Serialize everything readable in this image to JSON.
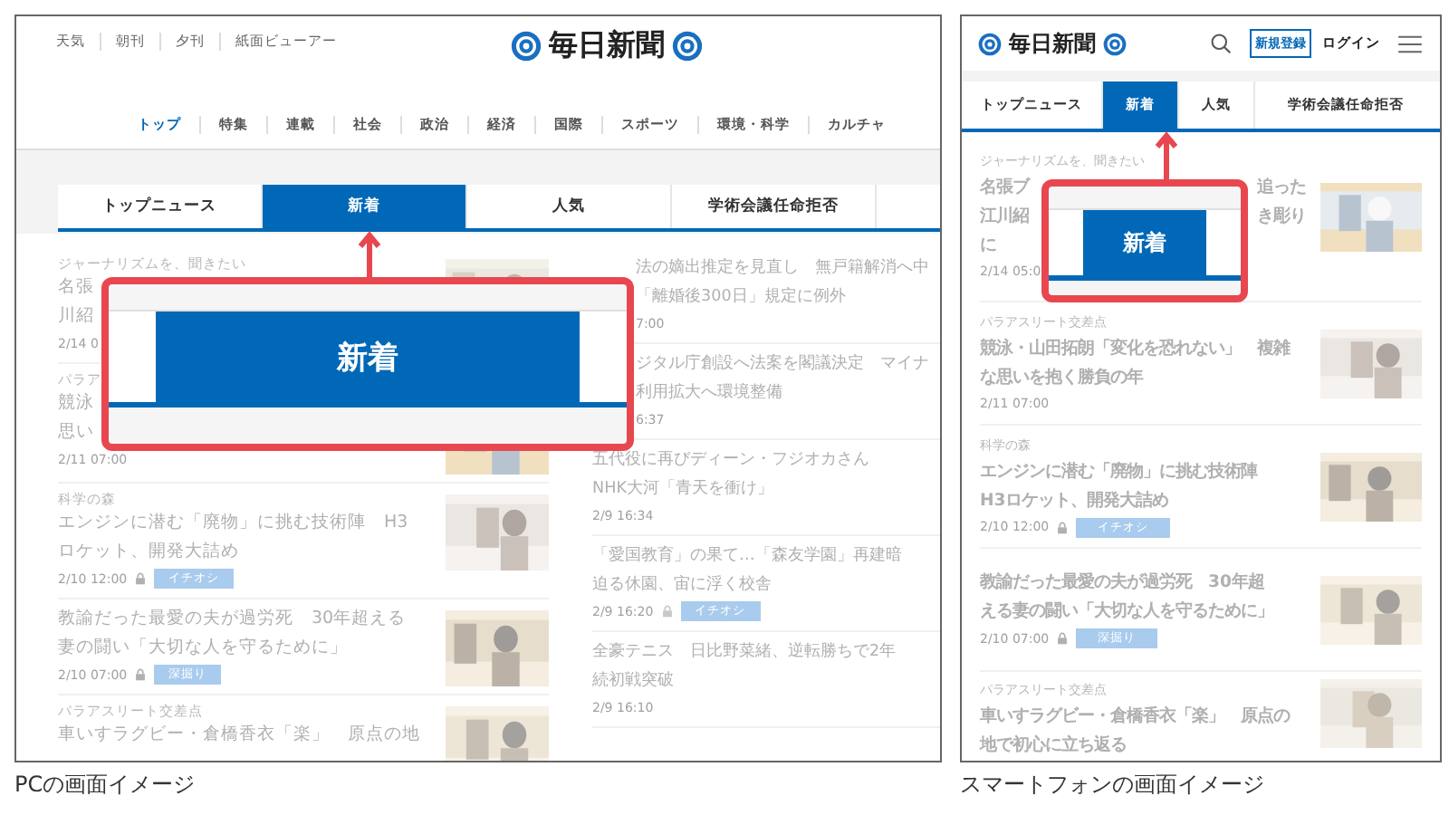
{
  "pc": {
    "top_links": [
      "天気",
      "朝刊",
      "夕刊",
      "紙面ビューアー"
    ],
    "logo": "毎日新聞",
    "nav": [
      {
        "label": "トップ",
        "selected": true
      },
      {
        "label": "特集",
        "selected": false
      },
      {
        "label": "連載",
        "selected": false
      },
      {
        "label": "社会",
        "selected": false
      },
      {
        "label": "政治",
        "selected": false
      },
      {
        "label": "経済",
        "selected": false
      },
      {
        "label": "国際",
        "selected": false
      },
      {
        "label": "スポーツ",
        "selected": false
      },
      {
        "label": "環境・科学",
        "selected": false
      },
      {
        "label": "カルチャ",
        "selected": false
      }
    ],
    "tabs": [
      {
        "label": "トップニュース",
        "selected": false
      },
      {
        "label": "新着",
        "selected": true
      },
      {
        "label": "人気",
        "selected": false
      },
      {
        "label": "学術会議任命拒否",
        "selected": false
      }
    ],
    "left_articles": [
      {
        "category": "ジャーナリズムを、聞きたい",
        "lines": [
          "名張",
          "川紹"
        ],
        "date": "2/14 0",
        "locked": false,
        "thumbnail": {
          "kind": "picture"
        }
      },
      {
        "category": "パラア",
        "lines": [
          "競泳",
          "思い"
        ],
        "date": "2/11 07:00",
        "locked": false,
        "thumbnail": {
          "kind": "picture"
        }
      },
      {
        "category": "科学の森",
        "lines": [
          "エンジンに潜む「廃物」に挑む技術陣　H3",
          "ロケット、開発大詰め"
        ],
        "date": "2/10 12:00",
        "locked": true,
        "tag": "イチオシ",
        "thumbnail": {
          "kind": "picture"
        }
      },
      {
        "lines": [
          "教諭だった最愛の夫が過労死　30年超える",
          "妻の闘い「大切な人を守るために」"
        ],
        "date": "2/10 07:00",
        "locked": true,
        "tag": "深掘り",
        "thumbnail": {
          "kind": "picture"
        }
      },
      {
        "category": "パラアスリート交差点",
        "lines": [
          "車いすラグビー・倉橋香衣「楽」　原点の地"
        ],
        "locked": false,
        "thumbnail": {
          "kind": "picture"
        }
      }
    ],
    "right_articles": [
      {
        "lines": [
          "法の嫡出推定を見直し　無戸籍解消へ中",
          "「離婚後300日」規定に例外"
        ],
        "date": "7:00",
        "locked": false
      },
      {
        "lines": [
          "ジタル庁創設へ法案を閣議決定　マイナ",
          "利用拡大へ環境整備"
        ],
        "date": "6:37",
        "locked": false
      },
      {
        "lines": [
          "五代役に再びディーン・フジオカさん",
          "NHK大河「青天を衝け」"
        ],
        "date": "2/9 16:34",
        "locked": false
      },
      {
        "lines": [
          "「愛国教育」の果て…「森友学園」再建暗",
          "迫る休園、宙に浮く校舎"
        ],
        "date": "2/9 16:20",
        "locked": true,
        "tag": "イチオシ"
      },
      {
        "lines": [
          "全豪テニス　日比野菜緒、逆転勝ちで2年",
          "続初戦突破"
        ],
        "date": "2/9 16:10",
        "locked": false
      }
    ],
    "callout": {
      "label": "新着"
    },
    "caption": "PCの画面イメージ"
  },
  "phone": {
    "logo": "毎日新聞",
    "register": "新規登録",
    "login": "ログイン",
    "tabs": [
      {
        "label": "トップニュース",
        "selected": false
      },
      {
        "label": "新着",
        "selected": true
      },
      {
        "label": "人気",
        "selected": false
      },
      {
        "label": "学術会議任命拒否",
        "selected": false
      }
    ],
    "articles": [
      {
        "category": "ジャーナリズムを、聞きたい",
        "split_lines": [
          {
            "left": "名張ブ",
            "right": "追った"
          },
          {
            "left": "江川紹",
            "right": "き彫り"
          },
          {
            "left": "に"
          }
        ],
        "date": "2/14 05:0",
        "locked": false,
        "thumbnail": {
          "kind": "picture"
        }
      },
      {
        "category": "パラアスリート交差点",
        "lines": [
          "競泳・山田拓朗「変化を恐れない」　複雑",
          "な思いを抱く勝負の年"
        ],
        "date": "2/11 07:00",
        "locked": false,
        "thumbnail": {
          "kind": "picture"
        }
      },
      {
        "category": "科学の森",
        "lines": [
          "エンジンに潜む「廃物」に挑む技術陣",
          "H3ロケット、開発大詰め"
        ],
        "date": "2/10 12:00",
        "locked": true,
        "tag": "イチオシ",
        "thumbnail": {
          "kind": "picture"
        }
      },
      {
        "lines": [
          "教諭だった最愛の夫が過労死　30年超",
          "える妻の闘い「大切な人を守るために」"
        ],
        "date": "2/10 07:00",
        "locked": true,
        "tag": "深掘り",
        "thumbnail": {
          "kind": "picture"
        }
      },
      {
        "category": "パラアスリート交差点",
        "lines": [
          "車いすラグビー・倉橋香衣「楽」　原点の",
          "地で初心に立ち返る"
        ],
        "locked": false,
        "thumbnail": {
          "kind": "picture"
        }
      }
    ],
    "callout": {
      "label": "新着"
    },
    "caption": "スマートフォンの画面イメージ"
  }
}
